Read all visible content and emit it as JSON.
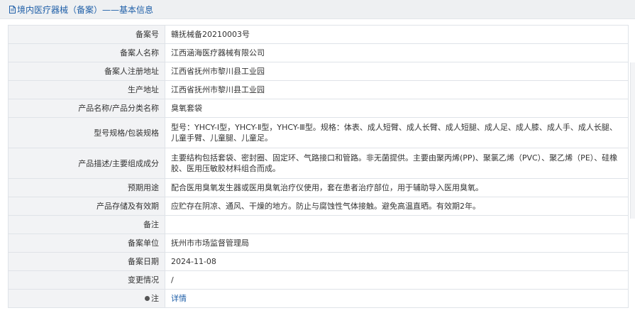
{
  "header": {
    "title": "境内医疗器械（备案）——基本信息",
    "icon": "document-icon"
  },
  "rows": [
    {
      "label": "备案号",
      "value": "赣抚械备20210003号"
    },
    {
      "label": "备案人名称",
      "value": "江西涵海医疗器械有限公司"
    },
    {
      "label": "备案人注册地址",
      "value": "江西省抚州市黎川县工业园"
    },
    {
      "label": "生产地址",
      "value": "江西省抚州市黎川县工业园"
    },
    {
      "label": "产品名称/产品分类名称",
      "value": "臭氧套袋"
    },
    {
      "label": "型号规格/包装规格",
      "value": "型号：YHCY-Ⅰ型，YHCY-Ⅱ型，YHCY-Ⅲ型。规格：体表、成人短臂、成人长臂、成人短腿、成人足、成人膝、成人手、成人长腿、儿童手臂、儿童腿、儿童足。"
    },
    {
      "label": "产品描述/主要组成成分",
      "value": "主要结构包括套袋、密封圈、固定环、气路接口和管路。非无菌提供。主要由聚丙烯(PP)、聚氯乙烯（PVC）、聚乙烯（PE）、硅橡胶、医用压敏胶材料组合而成。"
    },
    {
      "label": "预期用途",
      "value": "配合医用臭氧发生器或医用臭氧治疗仪使用，套在患者治疗部位，用于辅助导入医用臭氧。"
    },
    {
      "label": "产品存储及有效期",
      "value": "应贮存在阴凉、通风、干燥的地方。防止与腐蚀性气体接触。避免高温直晒。有效期2年。"
    },
    {
      "label": "备注",
      "value": ""
    },
    {
      "label": "备案单位",
      "value": "抚州市市场监督管理局"
    },
    {
      "label": "备案日期",
      "value": "2024-11-08"
    },
    {
      "label": "变更情况",
      "value": "/"
    }
  ],
  "note": {
    "label": "注",
    "link_text": "详情",
    "icon": "map-pin-icon"
  },
  "colors": {
    "link": "#1f5fa8",
    "label_bg": "#f2f3f5",
    "border": "#dfe3e8"
  }
}
